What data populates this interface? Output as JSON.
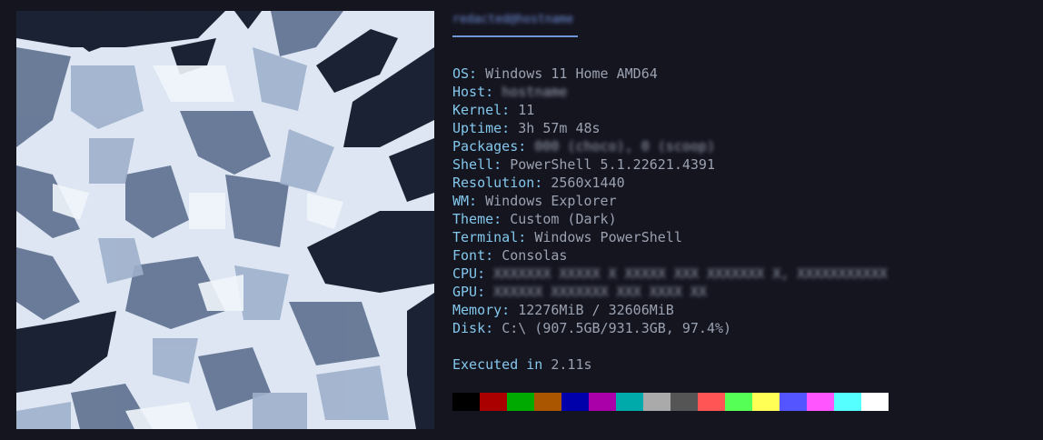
{
  "header": {
    "user_host": "redacted@hostname"
  },
  "info_rows": [
    {
      "key": "OS:",
      "value": "Windows 11 Home AMD64",
      "redacted": false
    },
    {
      "key": "Host:",
      "value": "hostname",
      "redacted": true
    },
    {
      "key": "Kernel:",
      "value": "11",
      "redacted": false
    },
    {
      "key": "Uptime:",
      "value": "3h 57m 48s",
      "redacted": false
    },
    {
      "key": "Packages:",
      "value": "000 (choco), 0 (scoop)",
      "redacted": true
    },
    {
      "key": "Shell:",
      "value": "PowerShell 5.1.22621.4391",
      "redacted": false
    },
    {
      "key": "Resolution:",
      "value": "2560x1440",
      "redacted": false
    },
    {
      "key": "WM:",
      "value": "Windows Explorer",
      "redacted": false
    },
    {
      "key": "Theme:",
      "value": "Custom (Dark)",
      "redacted": false
    },
    {
      "key": "Terminal:",
      "value": "Windows PowerShell",
      "redacted": false
    },
    {
      "key": "Font:",
      "value": "Consolas",
      "redacted": false
    },
    {
      "key": "CPU:",
      "value": "XXXXXXX XXXXX X XXXXX XXX XXXXXXX X, XXXXXXXXXXX",
      "redacted": true
    },
    {
      "key": "GPU:",
      "value": "XXXXXX XXXXXXX XXX XXXX XX",
      "redacted": true
    },
    {
      "key": "Memory:",
      "value": "12276MiB / 32606MiB",
      "redacted": false
    },
    {
      "key": "Disk:",
      "value": "C:\\ (907.5GB/931.3GB, 97.4%)",
      "redacted": false
    }
  ],
  "executed": {
    "label": "Executed in",
    "value": "2.11s"
  },
  "palette": [
    "#000000",
    "#aa0000",
    "#00aa00",
    "#aa5500",
    "#0000aa",
    "#aa00aa",
    "#00aaaa",
    "#aaaaaa",
    "#555555",
    "#ff5555",
    "#55ff55",
    "#ffff55",
    "#5555ff",
    "#ff55ff",
    "#55ffff",
    "#ffffff"
  ],
  "colors": {
    "background": "#151520",
    "key": "#83c8ec",
    "value": "#9aa1b0",
    "accent": "#6f97d8"
  }
}
